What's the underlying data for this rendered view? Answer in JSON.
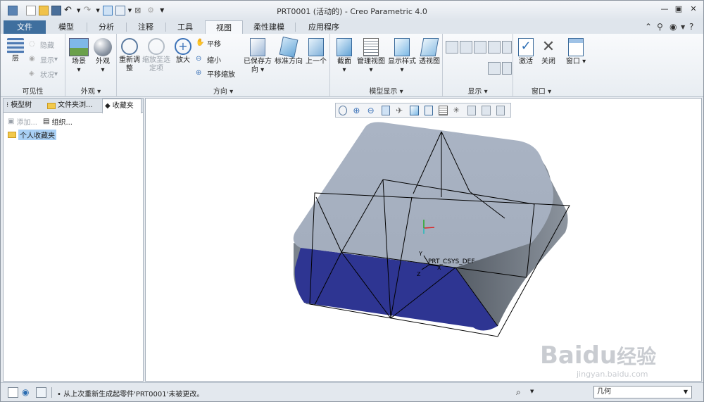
{
  "window": {
    "title": "PRT0001 (活动的) - Creo Parametric 4.0",
    "controls": [
      "minimize-icon",
      "maximize-icon",
      "close-icon"
    ]
  },
  "quick_access": [
    "new-icon",
    "open-icon",
    "save-icon",
    "undo-icon",
    "redo-icon",
    "regenerate-icon",
    "windows-icon",
    "close-window-icon",
    "customize-icon"
  ],
  "tabs": [
    "文件",
    "模型",
    "分析",
    "注释",
    "工具",
    "视图",
    "柔性建模",
    "应用程序"
  ],
  "active_tab": "视图",
  "ribbon": {
    "visibility": {
      "label": "可见性",
      "layer": "层",
      "hide": "隐藏",
      "show": "显示",
      "status": "状况"
    },
    "appearance": {
      "label": "外观",
      "scene": "场景",
      "appearance": "外观"
    },
    "orientation": {
      "label": "方向",
      "refit": "重新调\n整",
      "zoom_selected": "缩放至选\n定项",
      "zoom_in": "放大",
      "pan": "平移",
      "zoom_out": "缩小",
      "pan_zoom": "平移缩放",
      "saved": "已保存方\n向",
      "standard": "标准方向",
      "previous": "上一个"
    },
    "model_display": {
      "label": "模型显示",
      "section": "截面",
      "manage_views": "管理视图",
      "display_style": "显示样式",
      "perspective": "透视图"
    },
    "display": {
      "label": "显示"
    },
    "window_grp": {
      "label": "窗口",
      "activate": "激活",
      "close": "关闭",
      "window": "窗口"
    }
  },
  "left_panel": {
    "tabs": [
      "模型树",
      "文件夹浏...",
      "收藏夹"
    ],
    "active_tab": "收藏夹",
    "actions": {
      "add": "添加...",
      "organize": "组织..."
    },
    "items": [
      "个人收藏夹"
    ]
  },
  "viewport": {
    "csys_label": "PRT_CSYS_DEF",
    "axis_x": "X",
    "axis_y": "Y",
    "axis_z": "Z",
    "colors": {
      "top_face": "#a7b1c1",
      "front_face": "#2e3592",
      "side_face": "#6b737d"
    }
  },
  "watermark": {
    "brand": "Baidu",
    "sub": "经验",
    "url": "jingyan.baidu.com"
  },
  "status_bar": {
    "message": "• 从上次重新生成起零件'PRT0001'未被更改。",
    "filter": "几何"
  }
}
